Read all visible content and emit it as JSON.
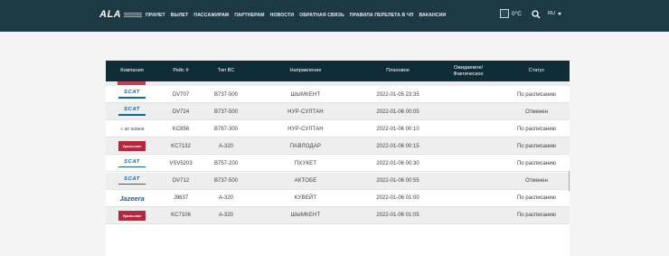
{
  "header": {
    "logo_text": "ALA",
    "nav": [
      "ПРИЛЕТ",
      "ВЫЛЕТ",
      "ПАССАЖИРАМ",
      "ПАРТНЕРАМ",
      "НОВОСТИ",
      "ОБРАТНАЯ СВЯЗЬ",
      "ПРАВИЛА ПЕРЕЛЕТА В ЧП",
      "ВАКАНСИИ"
    ],
    "temperature": "0°C",
    "language": "RU"
  },
  "table": {
    "columns": [
      "Компания",
      "Рейс #",
      "Тип ВС",
      "Направление",
      "Плановое",
      "Ожидаемое/\nФактическое",
      "Статус"
    ],
    "rows": [
      {
        "airline_logo": "scat",
        "airline": "SCAT",
        "flight": "DV707",
        "aircraft": "B737-500",
        "destination": "ШЫМКЕНТ",
        "scheduled": "2022-01-05 23:35",
        "actual": "",
        "status": "По расписанию"
      },
      {
        "airline_logo": "scat",
        "airline": "SCAT",
        "flight": "DV724",
        "aircraft": "B737-500",
        "destination": "НУР-СУЛТАН",
        "scheduled": "2022-01-06 00:05",
        "actual": "",
        "status": "Отменен"
      },
      {
        "airline_logo": "air-astana",
        "airline": "air astana",
        "flight": "KC856",
        "aircraft": "B767-300",
        "destination": "НУР-СУЛТАН",
        "scheduled": "2022-01-06 00:10",
        "actual": "",
        "status": "По расписанию"
      },
      {
        "airline_logo": "ural",
        "airline": "Уральские",
        "flight": "KC7132",
        "aircraft": "A-320",
        "destination": "ПАВЛОДАР",
        "scheduled": "2022-01-06 00:15",
        "actual": "",
        "status": "По расписанию"
      },
      {
        "airline_logo": "scat",
        "airline": "SCAT",
        "flight": "VSV5203",
        "aircraft": "B757-200",
        "destination": "ПХУКЕТ",
        "scheduled": "2022-01-06 00:30",
        "actual": "",
        "status": "По расписанию"
      },
      {
        "airline_logo": "scat",
        "airline": "SCAT",
        "flight": "DV712",
        "aircraft": "B737-500",
        "destination": "АКТОБЕ",
        "scheduled": "2022-01-06 00:55",
        "actual": "",
        "status": "Отменен"
      },
      {
        "airline_logo": "jazeera",
        "airline": "Jazeera",
        "flight": "J9637",
        "aircraft": "A-320",
        "destination": "КУВЕЙТ",
        "scheduled": "2022-01-06 01:00",
        "actual": "",
        "status": "По расписанию"
      },
      {
        "airline_logo": "ural",
        "airline": "Уральские",
        "flight": "KC7106",
        "aircraft": "A-320",
        "destination": "ШЫМКЕНТ",
        "scheduled": "2022-01-06 01:05",
        "actual": "",
        "status": "По расписанию"
      }
    ]
  },
  "colors": {
    "topbar": "#1b3a44",
    "table_header": "#0e2d37",
    "row_shade": "#eeeeee"
  }
}
